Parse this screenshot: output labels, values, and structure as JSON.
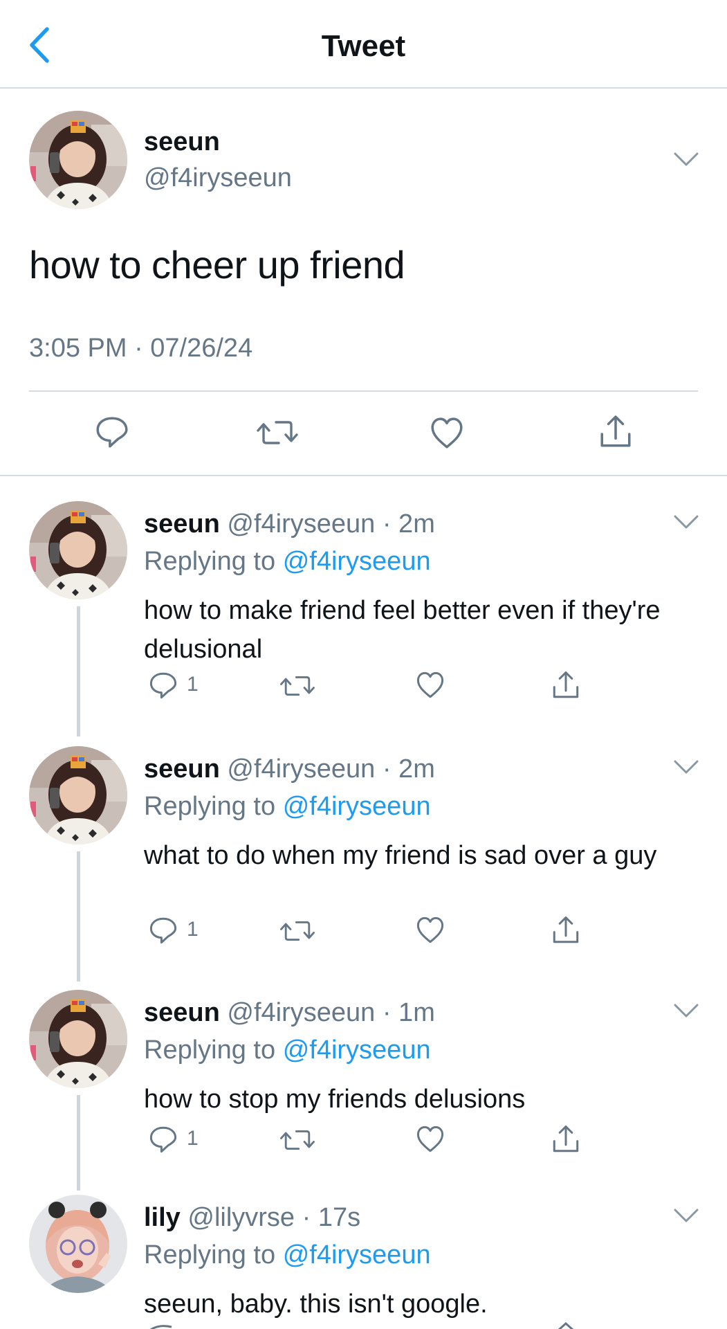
{
  "header": {
    "title": "Tweet",
    "back_icon": "chevron-left-icon"
  },
  "colors": {
    "accent": "#1d9bf0",
    "muted": "#657786",
    "divider": "#d6dbe0",
    "thread_line": "#ccd6dd"
  },
  "main_tweet": {
    "name": "seeun",
    "handle": "@f4iryseeun",
    "text": "how to cheer up friend",
    "timestamp": "3:05 PM · 07/26/24",
    "actions": [
      "reply-icon",
      "retweet-icon",
      "like-icon",
      "share-icon"
    ]
  },
  "replies": [
    {
      "name": "seeun",
      "meta": "@f4iryseeun · 2m",
      "replying_label": "Replying to",
      "replying_to": "@f4iryseeun",
      "text": "how to make friend feel better even if they're delusional",
      "reply_count": "1"
    },
    {
      "name": "seeun",
      "meta": "@f4iryseeun · 2m",
      "replying_label": "Replying to",
      "replying_to": "@f4iryseeun",
      "text": "what to do when my friend is sad over a guy",
      "reply_count": "1"
    },
    {
      "name": "seeun",
      "meta": "@f4iryseeun · 1m",
      "replying_label": "Replying to",
      "replying_to": "@f4iryseeun",
      "text": "how to stop my friends delusions",
      "reply_count": "1"
    },
    {
      "name": "lily",
      "meta": "@lilyvrse · 17s",
      "replying_label": "Replying to",
      "replying_to": "@f4iryseeun",
      "text": "seeun, baby. this isn't google.",
      "reply_count": ""
    }
  ]
}
